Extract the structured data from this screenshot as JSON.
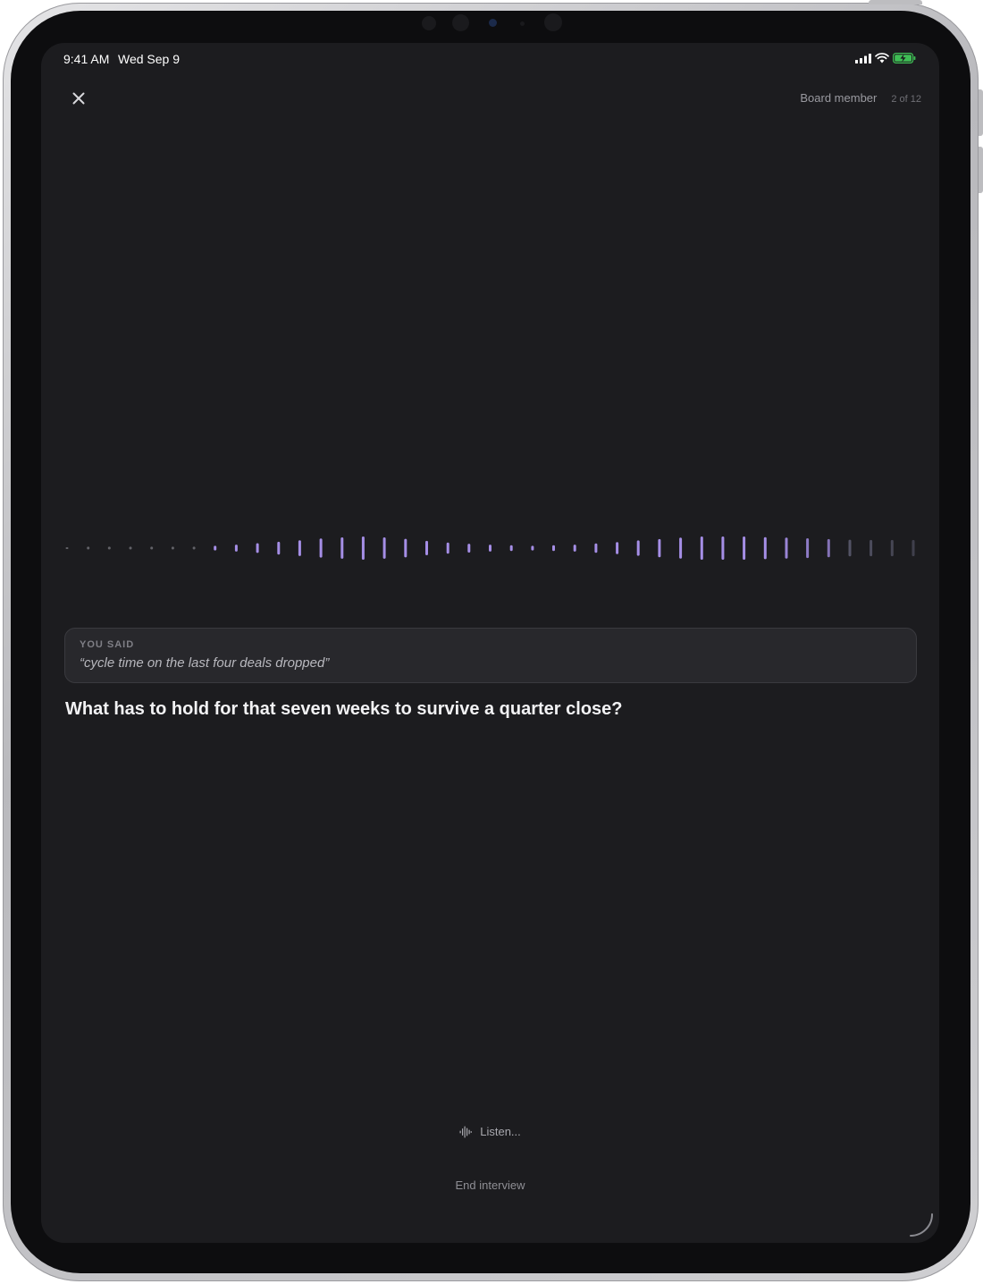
{
  "status_bar": {
    "time": "9:41 AM",
    "date": "Wed Sep 9"
  },
  "header": {
    "role": "Board member",
    "progress": "2 of 12"
  },
  "waveform": {
    "colors": {
      "active": "#a58ee6",
      "fading": "#6d6d86",
      "idle": "#6a6a70"
    },
    "levels": [
      0.05,
      0.12,
      0.12,
      0.12,
      0.12,
      0.12,
      0.12,
      0.2,
      0.3,
      0.42,
      0.55,
      0.68,
      0.82,
      0.92,
      1.0,
      0.92,
      0.8,
      0.62,
      0.48,
      0.38,
      0.3,
      0.25,
      0.2,
      0.25,
      0.3,
      0.4,
      0.52,
      0.66,
      0.78,
      0.9,
      1.0,
      1.0,
      1.0,
      0.95,
      0.9,
      0.85,
      0.78,
      0.72,
      0.7,
      0.7,
      0.7
    ]
  },
  "you_said": {
    "label": "YOU SAID",
    "text": "“cycle time on the last four deals dropped”"
  },
  "question": "What has to hold for that seven weeks to survive a quarter close?",
  "listen_label": "Listen...",
  "end_label": "End interview",
  "accent_color": "#a58ee6"
}
